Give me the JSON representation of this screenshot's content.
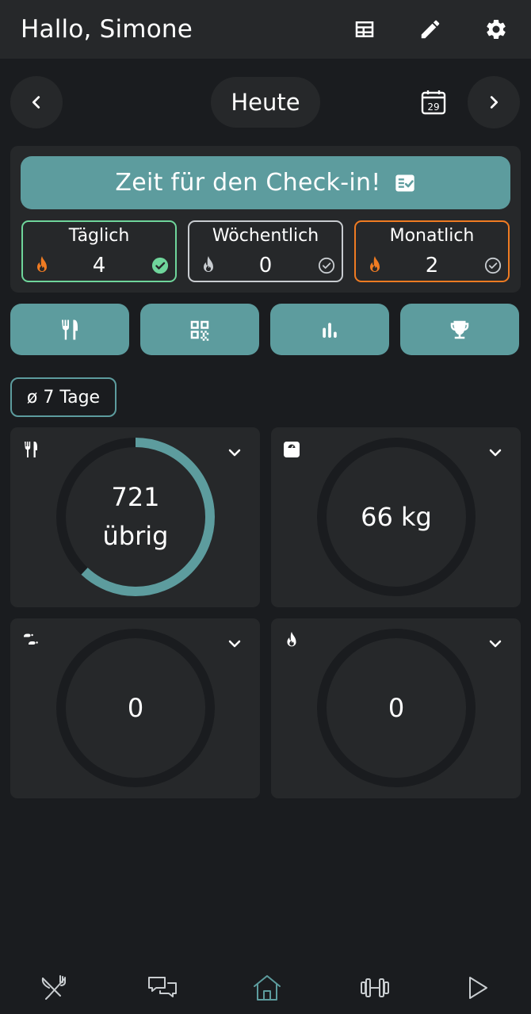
{
  "header": {
    "greeting": "Hallo, Simone",
    "icons": [
      "table-icon",
      "pencil-icon",
      "gear-icon"
    ]
  },
  "date_nav": {
    "today_label": "Heute",
    "calendar_day": "29"
  },
  "checkin": {
    "button_label": "Zeit für den Check-in!"
  },
  "streaks": [
    {
      "label": "Täglich",
      "value": "4",
      "border": "#6fd59b",
      "flame": "#ef7b22",
      "check": "#6fd59b",
      "checked": true
    },
    {
      "label": "Wöchentlich",
      "value": "0",
      "border": "#c8ccd0",
      "flame": "#c8ccd0",
      "check": "#c8ccd0",
      "checked": false
    },
    {
      "label": "Monatlich",
      "value": "2",
      "border": "#ef7b22",
      "flame": "#ef7b22",
      "check": "#c8ccd0",
      "checked": false
    }
  ],
  "quick_actions": [
    "utensils-icon",
    "qr-code-icon",
    "bar-chart-icon",
    "trophy-icon"
  ],
  "average_chip": "ø 7 Tage",
  "cards": [
    {
      "icon": "utensils-icon",
      "line1": "721",
      "line2": "übrig",
      "progress": 0.62
    },
    {
      "icon": "scale-icon",
      "line1": "66 kg",
      "line2": "",
      "progress": 0
    },
    {
      "icon": "footsteps-icon",
      "line1": "0",
      "line2": "",
      "progress": 0
    },
    {
      "icon": "flame-icon",
      "line1": "0",
      "line2": "",
      "progress": 0
    }
  ],
  "colors": {
    "accent": "#5d9c9e",
    "background": "#1a1c1f",
    "surface": "#26282a",
    "ring_track": "#1a1c1f"
  },
  "bottom_nav": [
    "nutrition-icon",
    "chat-icon",
    "home-icon",
    "workout-icon",
    "play-icon"
  ],
  "bottom_nav_active": "home-icon"
}
